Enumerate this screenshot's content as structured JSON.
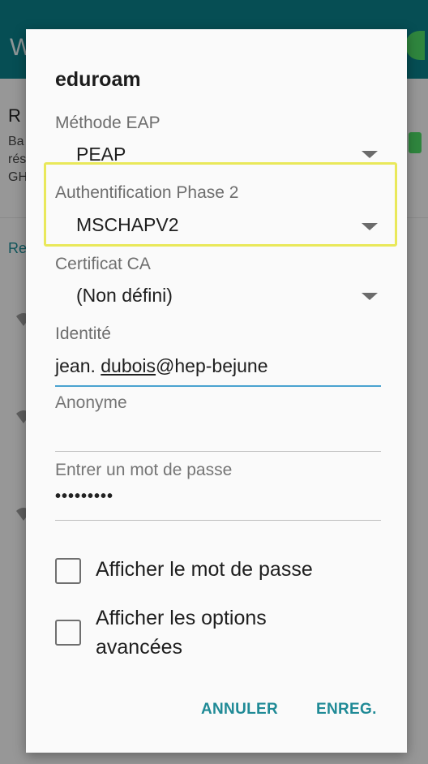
{
  "background": {
    "header_title": "W",
    "item_title_partial": "R",
    "item_sub_lines": [
      "Ba",
      "rés",
      "GH"
    ],
    "section_label_partial": "Re"
  },
  "dialog": {
    "title": "eduroam",
    "eap": {
      "label": "Méthode EAP",
      "value": "PEAP"
    },
    "phase2": {
      "label": "Authentification Phase 2",
      "value": "MSCHAPV2"
    },
    "ca": {
      "label": "Certificat CA",
      "value": "(Non défini)"
    },
    "identity": {
      "label": "Identité",
      "value_part1": "jean. ",
      "value_underlined": "dubois",
      "value_part3": "@hep-bejune"
    },
    "anonymous": {
      "placeholder": "Anonyme",
      "value": ""
    },
    "password": {
      "placeholder": "Entrer un mot de passe",
      "value": "•••••••••"
    },
    "show_password": {
      "label": "Afficher le mot de passe",
      "checked": false
    },
    "advanced": {
      "label_line1": "Afficher les options",
      "label_line2": "avancées",
      "checked": false
    },
    "buttons": {
      "cancel": "ANNULER",
      "save": "ENREG."
    }
  },
  "colors": {
    "accent": "#1f8a96",
    "header": "#0b7f88",
    "highlight": "#e9e85a"
  }
}
